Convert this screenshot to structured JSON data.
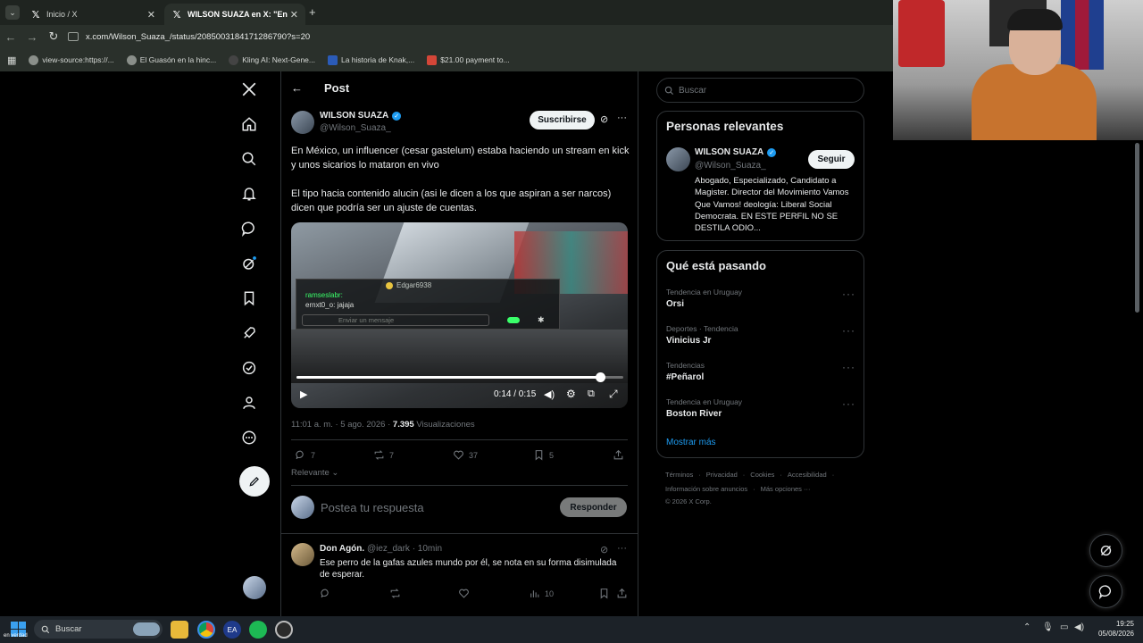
{
  "browser": {
    "tabs": [
      {
        "title": "Inicio / X",
        "active": false
      },
      {
        "title": "WILSON SUAZA en X: \"En Méxi",
        "active": true
      }
    ],
    "new_tab": "+",
    "url": "x.com/Wilson_Suaza_/status/2085003184171286790?s=20",
    "bookmarks": [
      "view-source:https://...",
      "El Guasón en la hinc...",
      "Kling AI: Next-Gene...",
      "La historia de Knak,...",
      "$21.00 payment to..."
    ]
  },
  "header": {
    "title": "Post"
  },
  "post": {
    "author_name": "WILSON SUAZA",
    "author_handle": "@Wilson_Suaza_",
    "subscribe_label": "Suscribirse",
    "text1": "En México, un influencer (cesar gastelum) estaba haciendo un stream en kick y unos sicarios lo mataron en vivo",
    "text2": "El tipo hacia contenido alucin (asi le dicen a los que aspiran a ser narcos) dicen que podría ser un ajuste de cuentas.",
    "time": "11:01 a. m. · 5 ago. 2026 · ",
    "views_count": "7.395",
    "views_label": " Visualizaciones",
    "video": {
      "overlay_user": "Edgar6938",
      "chat_line1": "ramseslabr:",
      "chat_line2": "ernxt0_o: jajaja",
      "chat_input": "Enviar un mensaje",
      "time_display": "0:14 / 0:15",
      "progress": 0.93
    },
    "stats": {
      "replies": "7",
      "reposts": "7",
      "likes": "37",
      "bookmarks": "5"
    },
    "sort_label": "Relevante"
  },
  "reply_box": {
    "placeholder": "Postea tu respuesta",
    "button": "Responder"
  },
  "comment": {
    "name": "Don Agón.",
    "handle": "@iez_dark",
    "time": "· 10min",
    "text": "Ese perro de la gafas azules mundo por él, se nota en su forma disimulada de esperar.",
    "views": "10"
  },
  "search": {
    "placeholder": "Buscar"
  },
  "relevant": {
    "title": "Personas relevantes",
    "name": "WILSON SUAZA",
    "handle": "@Wilson_Suaza_",
    "follow": "Seguir",
    "bio": "Abogado, Especializado, Candidato a Magister. Director del Movimiento Vamos Que Vamos! deología: Liberal Social Democrata. EN ESTE PERFIL NO SE DESTILA ODIO..."
  },
  "trends": {
    "title": "Qué está pasando",
    "items": [
      {
        "category": "Tendencia en Uruguay",
        "name": "Orsi"
      },
      {
        "category": "Deportes · Tendencia",
        "name": "Vinicius Jr"
      },
      {
        "category": "Tendencias",
        "name": "#Peñarol"
      },
      {
        "category": "Tendencia en Uruguay",
        "name": "Boston River"
      }
    ],
    "show_more": "Mostrar más"
  },
  "footer": {
    "links1": [
      "Términos",
      "Privacidad",
      "Cookies",
      "Accesibilidad"
    ],
    "links2": [
      "Información sobre anuncios",
      "Más opciones ···"
    ],
    "copyright": "© 2026 X Corp."
  },
  "taskbar": {
    "search": "Buscar",
    "time": "19:25",
    "date": "05/08/2026",
    "corner_text": "en verdad"
  },
  "colors": {
    "accent": "#1d9bf0",
    "verified": "#1d9bf0",
    "background": "#000000",
    "border": "#2f3336"
  }
}
